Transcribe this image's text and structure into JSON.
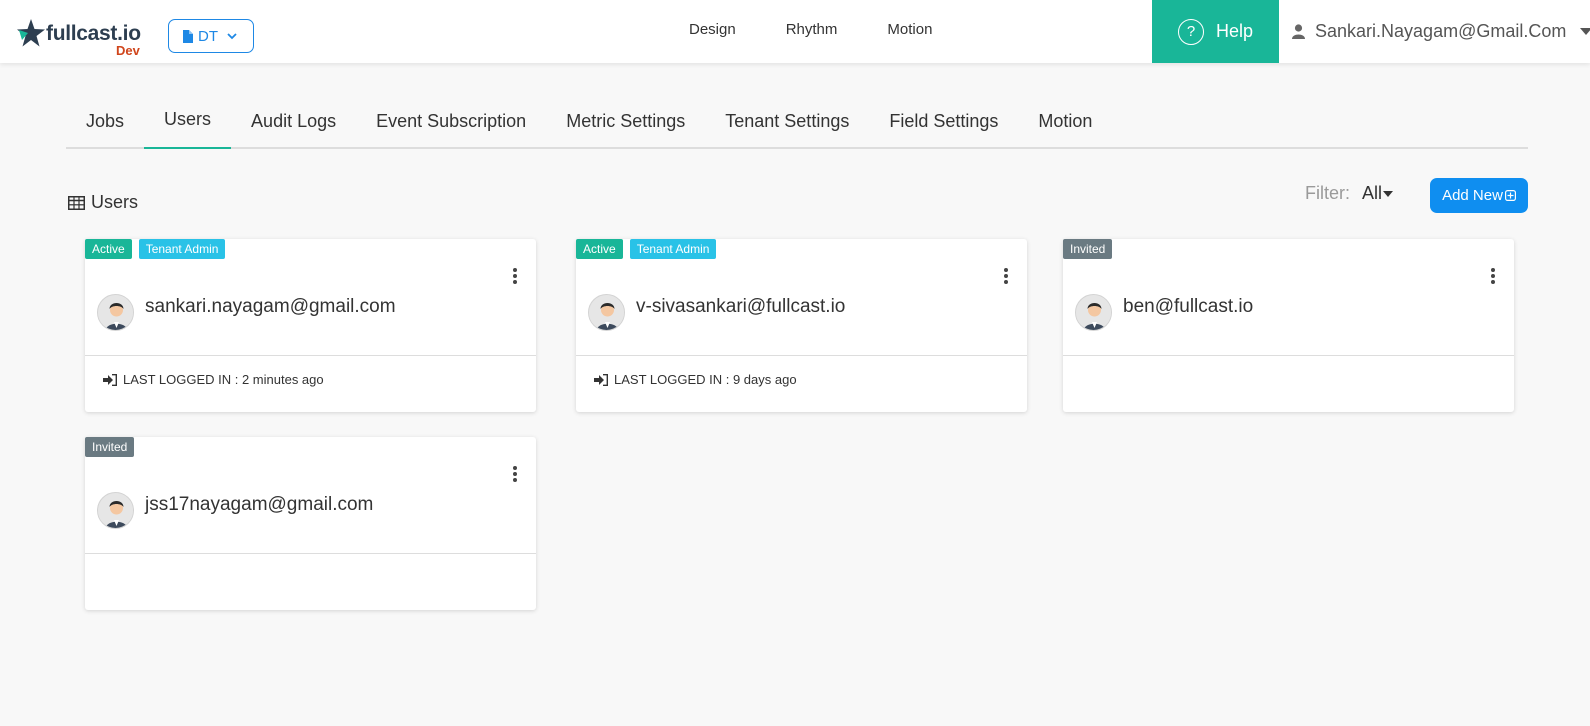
{
  "header": {
    "brand": "fullcast.io",
    "env": "Dev",
    "workspace_label": "DT",
    "nav": [
      "Design",
      "Rhythm",
      "Motion"
    ],
    "help_label": "Help",
    "user_email": "Sankari.Nayagam@Gmail.Com"
  },
  "tabs": [
    {
      "label": "Jobs",
      "active": false
    },
    {
      "label": "Users",
      "active": true
    },
    {
      "label": "Audit Logs",
      "active": false
    },
    {
      "label": "Event Subscription",
      "active": false
    },
    {
      "label": "Metric Settings",
      "active": false
    },
    {
      "label": "Tenant Settings",
      "active": false
    },
    {
      "label": "Field Settings",
      "active": false
    },
    {
      "label": "Motion",
      "active": false
    }
  ],
  "section": {
    "title": "Users",
    "filter_label": "Filter:",
    "filter_value": "All",
    "add_button": "Add New"
  },
  "users": [
    {
      "email": "sankari.nayagam@gmail.com",
      "badges": [
        "Active",
        "Tenant Admin"
      ],
      "last_login": "LAST LOGGED IN : 2 minutes ago"
    },
    {
      "email": "v-sivasankari@fullcast.io",
      "badges": [
        "Active",
        "Tenant Admin"
      ],
      "last_login": "LAST LOGGED IN : 9 days ago"
    },
    {
      "email": "ben@fullcast.io",
      "badges": [
        "Invited"
      ],
      "last_login": ""
    },
    {
      "email": "jss17nayagam@gmail.com",
      "badges": [
        "Invited"
      ],
      "last_login": ""
    }
  ],
  "colors": {
    "accent_green": "#19b698",
    "primary_blue": "#0f8ef0",
    "admin_cyan": "#29c2e7",
    "invited_gray": "#6a7a82",
    "logo_dev_red": "#d0451b"
  }
}
